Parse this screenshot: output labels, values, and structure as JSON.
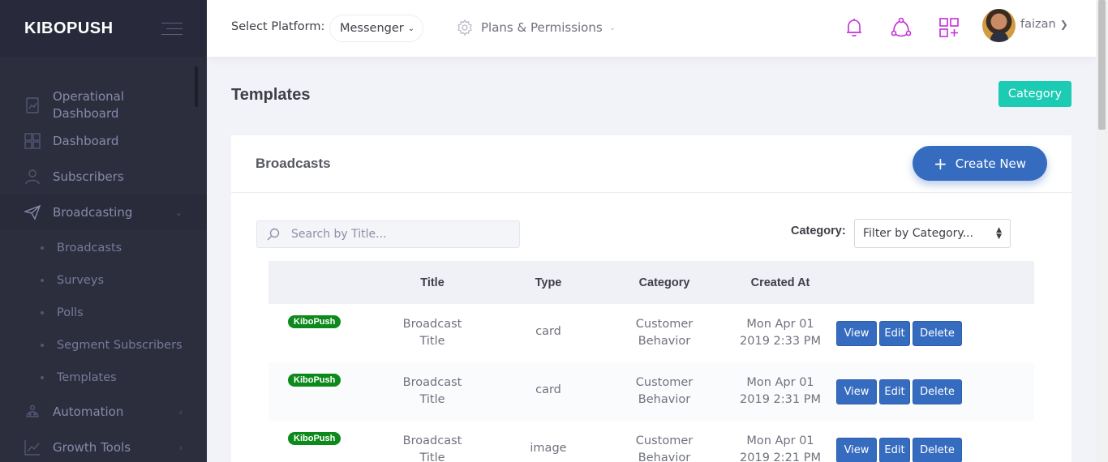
{
  "brand": {
    "name": "KIBOPUSH"
  },
  "sidebar": {
    "items": [
      {
        "label": "Operational Dashboard",
        "icon": "chart-icon"
      },
      {
        "label": "Dashboard",
        "icon": "grid-icon"
      },
      {
        "label": "Subscribers",
        "icon": "user-icon"
      },
      {
        "label": "Broadcasting",
        "icon": "paper-plane-icon",
        "expanded": true
      },
      {
        "label": "Automation",
        "icon": "robot-icon"
      },
      {
        "label": "Growth Tools",
        "icon": "growth-chart-icon"
      }
    ],
    "subitems": [
      "Broadcasts",
      "Surveys",
      "Polls",
      "Segment Subscribers",
      "Templates"
    ]
  },
  "header": {
    "platform_label": "Select Platform:",
    "platform_value": "Messenger",
    "plans_label": "Plans & Permissions",
    "username": "faizan",
    "accent_color": "#c42fd8"
  },
  "page": {
    "title": "Templates",
    "category_button": "Category"
  },
  "portlet": {
    "title": "Broadcasts",
    "create_button": "Create New",
    "search_placeholder": "Search by Title...",
    "filter_label": "Category:",
    "filter_value": "Filter by Category..."
  },
  "table": {
    "columns": [
      "",
      "Title",
      "Type",
      "Category",
      "Created At",
      ""
    ],
    "rows": [
      {
        "badge": "KiboPush",
        "title_1": "Broadcast",
        "title_2": "Title",
        "type": "card",
        "cat_1": "Customer",
        "cat_2": "Behavior",
        "date_1": "Mon Apr 01",
        "date_2": "2019 2:33 PM"
      },
      {
        "badge": "KiboPush",
        "title_1": "Broadcast",
        "title_2": "Title",
        "type": "card",
        "cat_1": "Customer",
        "cat_2": "Behavior",
        "date_1": "Mon Apr 01",
        "date_2": "2019 2:31 PM"
      },
      {
        "badge": "KiboPush",
        "title_1": "Broadcast",
        "title_2": "Title",
        "type": "image",
        "cat_1": "Customer",
        "cat_2": "Behavior",
        "date_1": "Mon Apr 01",
        "date_2": "2019 2:21 PM"
      }
    ],
    "actions": {
      "view": "View",
      "edit": "Edit",
      "delete": "Delete"
    }
  }
}
